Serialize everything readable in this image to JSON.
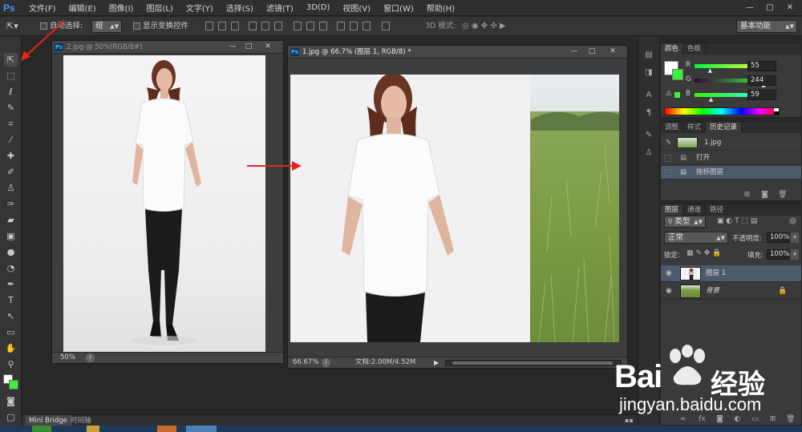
{
  "app": {
    "logo": "Ps",
    "menu": [
      "文件(F)",
      "编辑(E)",
      "图像(I)",
      "图层(L)",
      "文字(Y)",
      "选择(S)",
      "滤镜(T)",
      "3D(D)",
      "视图(V)",
      "窗口(W)",
      "帮助(H)"
    ],
    "window_controls": [
      "—",
      "□",
      "✕"
    ]
  },
  "options_bar": {
    "auto_select_label": "自动选择:",
    "auto_select_value": "组",
    "show_transform_label": "显示变换控件",
    "mode_3d_label": "3D 模式:",
    "workspace": "基本功能"
  },
  "doc_left": {
    "title": "2.jpg @ 50%(RGB/8#)",
    "zoom": "50%"
  },
  "doc_right": {
    "title": "1.jpg @ 66.7% (图层 1, RGB/8) *",
    "zoom": "66.67%",
    "doc_info": "文档:2.00M/4.52M"
  },
  "color_panel": {
    "tabs": [
      "颜色",
      "色板"
    ],
    "r_label": "R",
    "r_value": "55",
    "g_label": "G",
    "g_value": "244",
    "b_label": "B",
    "b_value": "59",
    "r_fraction": 0.22,
    "g_fraction": 0.96,
    "b_fraction": 0.23,
    "fg_color": "#37f43b"
  },
  "history_panel": {
    "tabs": [
      "调整",
      "样式",
      "历史记录"
    ],
    "snapshot": "1.jpg",
    "items": [
      "打开",
      "拖移图层"
    ]
  },
  "layers_panel": {
    "tabs": [
      "图层",
      "通道",
      "路径"
    ],
    "filter_label": "类型",
    "blend_mode": "正常",
    "opacity_label": "不透明度:",
    "opacity_value": "100%",
    "lock_label": "锁定:",
    "fill_label": "填充:",
    "fill_value": "100%",
    "layers": [
      "图层 1",
      "背景"
    ]
  },
  "bottom_tabs": [
    "Mini Bridge",
    "时间轴"
  ],
  "watermark": {
    "brand_latin": "Bai",
    "brand_cn": "经验",
    "url": "jingyan.baidu.com"
  }
}
